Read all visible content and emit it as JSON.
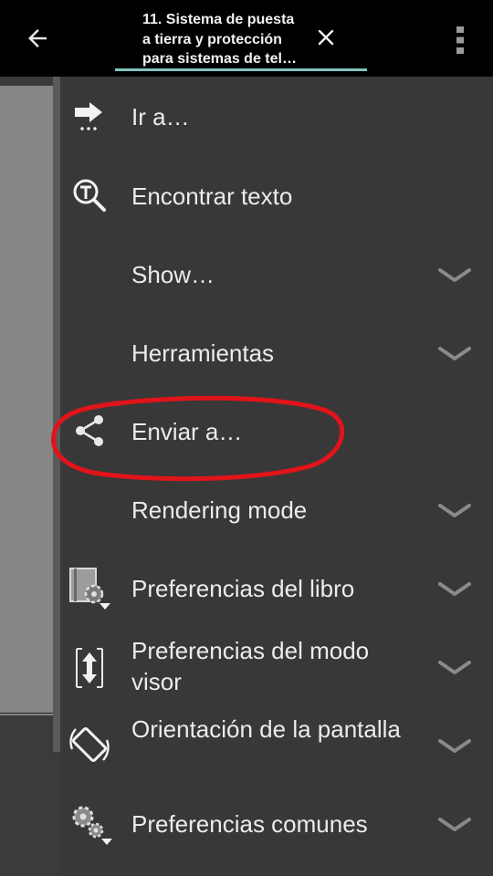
{
  "topbar": {
    "tab_title": "11. Sistema de puesta\na tierra y protección\npara sistemas de tel…",
    "back_icon": "arrow-left-icon",
    "close_icon": "close-icon",
    "more_icon": "more-vertical-icon"
  },
  "menu": {
    "items": [
      {
        "label": "Ir a…",
        "icon": "goto-arrow-icon",
        "expandable": false
      },
      {
        "label": "Encontrar texto",
        "icon": "find-text-icon",
        "expandable": false
      },
      {
        "label": "Show…",
        "icon": "",
        "expandable": true
      },
      {
        "label": "Herramientas",
        "icon": "",
        "expandable": true
      },
      {
        "label": "Enviar a…",
        "icon": "share-icon",
        "expandable": false
      },
      {
        "label": "Rendering mode",
        "icon": "",
        "expandable": true
      },
      {
        "label": "Preferencias del libro",
        "icon": "book-settings-icon",
        "expandable": true
      },
      {
        "label": "Preferencias del modo visor",
        "icon": "viewer-mode-icon",
        "expandable": true
      },
      {
        "label": "Orientación de la pantalla",
        "icon": "screen-rotation-icon",
        "expandable": true
      },
      {
        "label": "Preferencias comunes",
        "icon": "common-settings-icon",
        "expandable": true
      }
    ]
  },
  "colors": {
    "topbar_bg": "#000000",
    "menu_bg": "#383838",
    "text": "#ececec",
    "tab_underline": "#7fc6c2",
    "annotation": "#e0141a"
  }
}
